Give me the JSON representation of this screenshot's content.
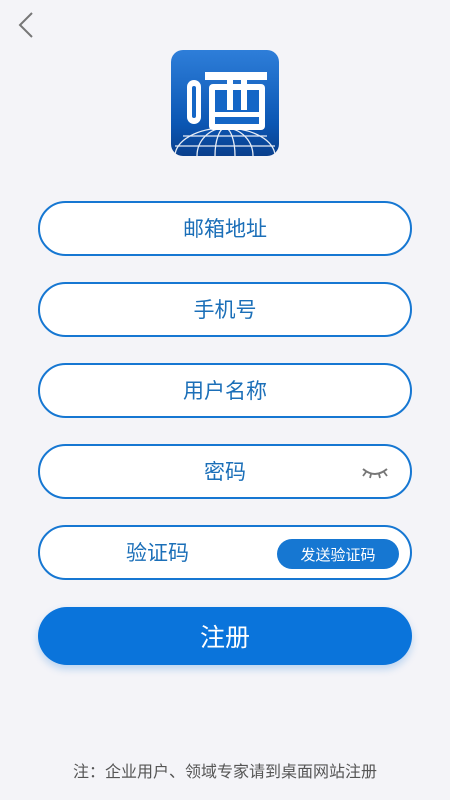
{
  "logo": {
    "glyph": "晒",
    "accent": "#1677d2"
  },
  "form": {
    "email_placeholder": "邮箱地址",
    "phone_placeholder": "手机号",
    "username_placeholder": "用户名称",
    "password_placeholder": "密码",
    "code_placeholder": "验证码",
    "send_code_label": "发送验证码"
  },
  "actions": {
    "register_label": "注册"
  },
  "footer": {
    "note": "注：企业用户、领域专家请到桌面网站注册"
  },
  "colors": {
    "primary": "#0a74db",
    "border": "#1677d2",
    "text": "#1b6fb8",
    "background": "#f4f4f8"
  },
  "icons": {
    "back": "chevron-left-icon",
    "password_toggle": "closed-eye-icon"
  }
}
